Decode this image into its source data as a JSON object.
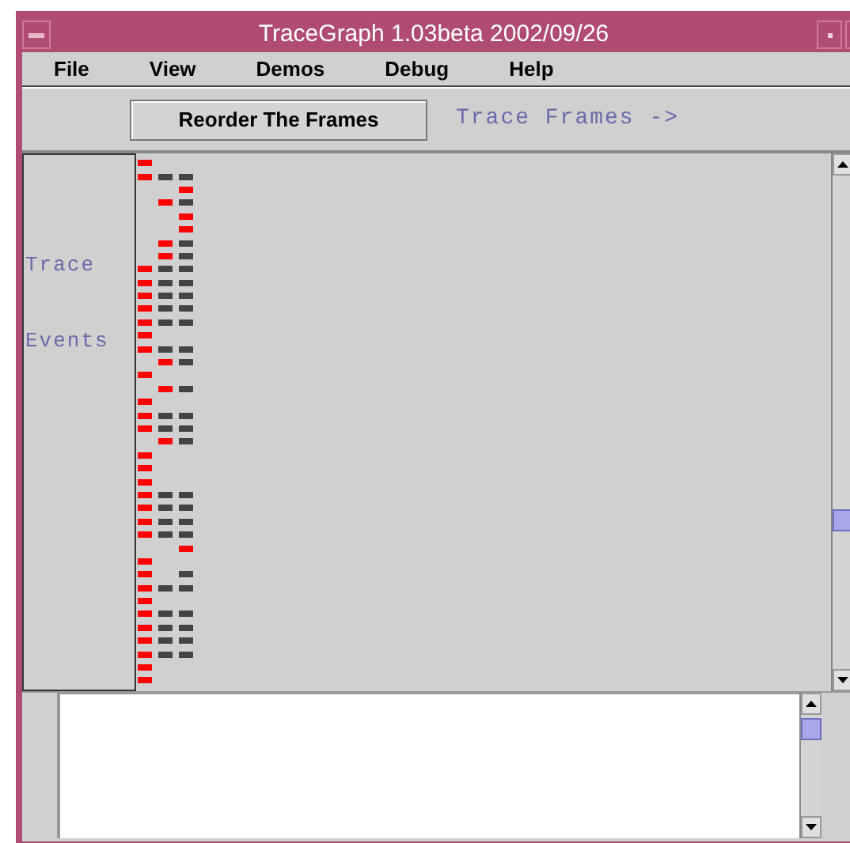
{
  "window": {
    "title": "TraceGraph 1.03beta 2002/09/26"
  },
  "menu": [
    "File",
    "View",
    "Demos",
    "Debug",
    "Help"
  ],
  "toolbar": {
    "button": "Reorder The Frames",
    "label": "Trace Frames ->"
  },
  "side_labels": [
    "Trace",
    "Events"
  ],
  "trace_rows": [
    {
      "marks": [
        {
          "kind": "red"
        },
        {
          "kind": "blank"
        },
        {
          "kind": "blank"
        }
      ]
    },
    {
      "marks": [
        {
          "kind": "red"
        },
        {
          "kind": "dark"
        },
        {
          "kind": "dark"
        }
      ]
    },
    {
      "marks": [
        {
          "kind": "blank"
        },
        {
          "kind": "blank"
        },
        {
          "kind": "red"
        }
      ]
    },
    {
      "marks": [
        {
          "kind": "blank"
        },
        {
          "kind": "red"
        },
        {
          "kind": "dark"
        }
      ]
    },
    {
      "marks": [
        {
          "kind": "blank"
        },
        {
          "kind": "blank"
        },
        {
          "kind": "red"
        }
      ]
    },
    {
      "marks": [
        {
          "kind": "blank"
        },
        {
          "kind": "blank"
        },
        {
          "kind": "red"
        }
      ]
    },
    {
      "marks": [
        {
          "kind": "blank"
        },
        {
          "kind": "red"
        },
        {
          "kind": "dark"
        }
      ]
    },
    {
      "marks": [
        {
          "kind": "blank"
        },
        {
          "kind": "red"
        },
        {
          "kind": "dark"
        }
      ]
    },
    {
      "marks": [
        {
          "kind": "red"
        },
        {
          "kind": "dark"
        },
        {
          "kind": "dark"
        }
      ]
    },
    {
      "marks": [
        {
          "kind": "red"
        },
        {
          "kind": "dark"
        },
        {
          "kind": "dark"
        }
      ]
    },
    {
      "marks": [
        {
          "kind": "red"
        },
        {
          "kind": "dark"
        },
        {
          "kind": "dark"
        }
      ]
    },
    {
      "marks": [
        {
          "kind": "red"
        },
        {
          "kind": "dark"
        },
        {
          "kind": "dark"
        }
      ]
    },
    {
      "marks": [
        {
          "kind": "red"
        },
        {
          "kind": "dark"
        },
        {
          "kind": "dark"
        }
      ]
    },
    {
      "marks": [
        {
          "kind": "red"
        },
        {
          "kind": "blank"
        },
        {
          "kind": "blank"
        }
      ]
    },
    {
      "marks": [
        {
          "kind": "red"
        },
        {
          "kind": "dark"
        },
        {
          "kind": "dark"
        }
      ]
    },
    {
      "marks": [
        {
          "kind": "blank"
        },
        {
          "kind": "red"
        },
        {
          "kind": "dark"
        }
      ]
    },
    {
      "marks": [
        {
          "kind": "red"
        },
        {
          "kind": "blank"
        },
        {
          "kind": "blank"
        }
      ]
    },
    {
      "marks": [
        {
          "kind": "blank"
        },
        {
          "kind": "red"
        },
        {
          "kind": "dark"
        }
      ]
    },
    {
      "marks": [
        {
          "kind": "red"
        },
        {
          "kind": "blank"
        },
        {
          "kind": "blank"
        }
      ]
    },
    {
      "marks": [
        {
          "kind": "red"
        },
        {
          "kind": "dark"
        },
        {
          "kind": "dark"
        }
      ]
    },
    {
      "marks": [
        {
          "kind": "red"
        },
        {
          "kind": "dark"
        },
        {
          "kind": "dark"
        }
      ]
    },
    {
      "marks": [
        {
          "kind": "blank"
        },
        {
          "kind": "red"
        },
        {
          "kind": "dark"
        }
      ]
    },
    {
      "marks": [
        {
          "kind": "red"
        },
        {
          "kind": "blank"
        },
        {
          "kind": "blank"
        }
      ]
    },
    {
      "marks": [
        {
          "kind": "red"
        },
        {
          "kind": "blank"
        },
        {
          "kind": "blank"
        }
      ]
    },
    {
      "marks": [
        {
          "kind": "red"
        },
        {
          "kind": "blank"
        },
        {
          "kind": "blank"
        }
      ]
    },
    {
      "marks": [
        {
          "kind": "red"
        },
        {
          "kind": "dark"
        },
        {
          "kind": "dark"
        }
      ]
    },
    {
      "marks": [
        {
          "kind": "red"
        },
        {
          "kind": "dark"
        },
        {
          "kind": "dark"
        }
      ]
    },
    {
      "marks": [
        {
          "kind": "red"
        },
        {
          "kind": "dark"
        },
        {
          "kind": "dark"
        }
      ]
    },
    {
      "marks": [
        {
          "kind": "red"
        },
        {
          "kind": "dark"
        },
        {
          "kind": "dark"
        }
      ]
    },
    {
      "marks": [
        {
          "kind": "blank"
        },
        {
          "kind": "blank"
        },
        {
          "kind": "red"
        }
      ]
    },
    {
      "marks": [
        {
          "kind": "red"
        },
        {
          "kind": "blank"
        },
        {
          "kind": "blank"
        }
      ]
    },
    {
      "marks": [
        {
          "kind": "red"
        },
        {
          "kind": "blank"
        },
        {
          "kind": "dark"
        }
      ]
    },
    {
      "marks": [
        {
          "kind": "red"
        },
        {
          "kind": "dark"
        },
        {
          "kind": "dark"
        }
      ]
    },
    {
      "marks": [
        {
          "kind": "red"
        },
        {
          "kind": "blank"
        },
        {
          "kind": "blank"
        }
      ]
    },
    {
      "marks": [
        {
          "kind": "red"
        },
        {
          "kind": "dark"
        },
        {
          "kind": "dark"
        }
      ]
    },
    {
      "marks": [
        {
          "kind": "red"
        },
        {
          "kind": "dark"
        },
        {
          "kind": "dark"
        }
      ]
    },
    {
      "marks": [
        {
          "kind": "red"
        },
        {
          "kind": "dark"
        },
        {
          "kind": "dark"
        }
      ]
    },
    {
      "marks": [
        {
          "kind": "red"
        },
        {
          "kind": "dark"
        },
        {
          "kind": "dark"
        }
      ]
    },
    {
      "marks": [
        {
          "kind": "red"
        },
        {
          "kind": "blank"
        },
        {
          "kind": "blank"
        }
      ]
    },
    {
      "marks": [
        {
          "kind": "red"
        },
        {
          "kind": "blank"
        },
        {
          "kind": "blank"
        }
      ]
    }
  ]
}
